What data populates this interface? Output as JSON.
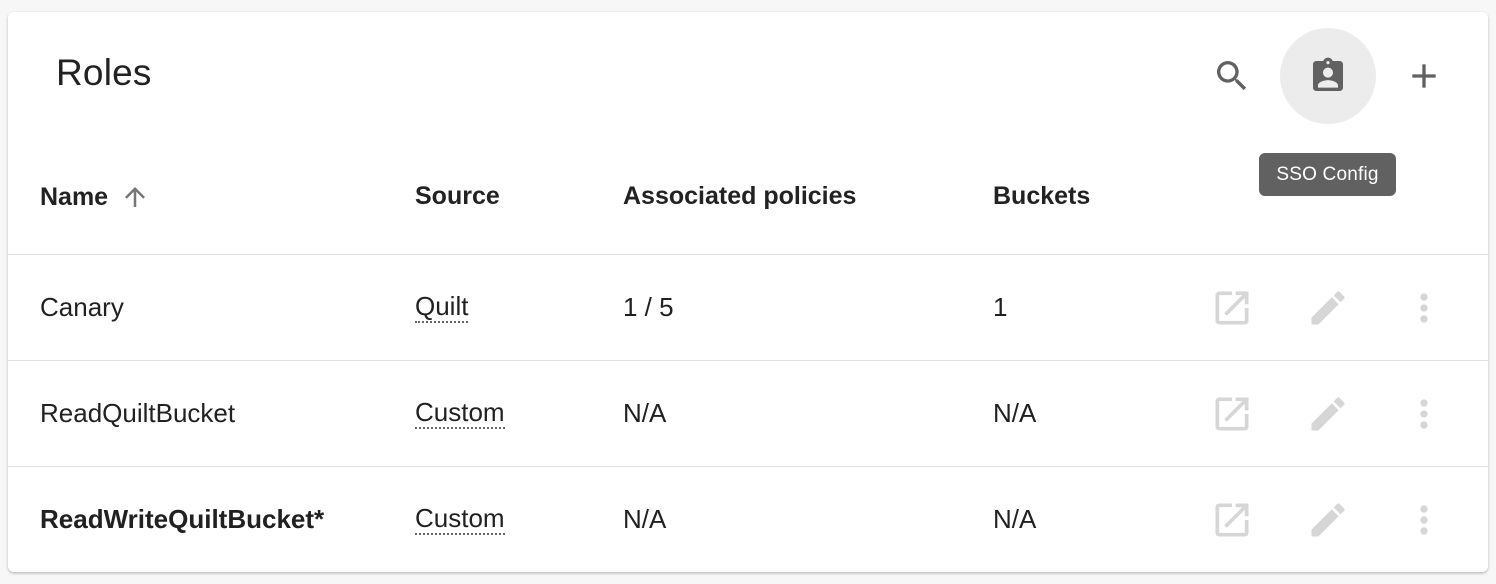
{
  "header": {
    "title": "Roles",
    "tooltip": "SSO Config"
  },
  "icons": {
    "search": "search-icon",
    "sso": "clipboard-account-icon",
    "add": "plus-icon",
    "sort": "arrow-up-icon",
    "open": "open-in-new-icon",
    "edit": "pencil-icon",
    "more": "more-vert-icon"
  },
  "table": {
    "columns": {
      "name": "Name",
      "source": "Source",
      "policies": "Associated policies",
      "buckets": "Buckets"
    },
    "sort": {
      "column": "name",
      "direction": "ascending"
    },
    "rows": [
      {
        "name": "Canary",
        "source": "Quilt",
        "policies": "1 / 5",
        "buckets": "1",
        "bold": false
      },
      {
        "name": "ReadQuiltBucket",
        "source": "Custom",
        "policies": "N/A",
        "buckets": "N/A",
        "bold": false
      },
      {
        "name": "ReadWriteQuiltBucket*",
        "source": "Custom",
        "policies": "N/A",
        "buckets": "N/A",
        "bold": true
      }
    ]
  },
  "colors": {
    "icon_active": "#616161",
    "icon_disabled": "#d6d6d6",
    "tooltip_bg": "#616161"
  }
}
